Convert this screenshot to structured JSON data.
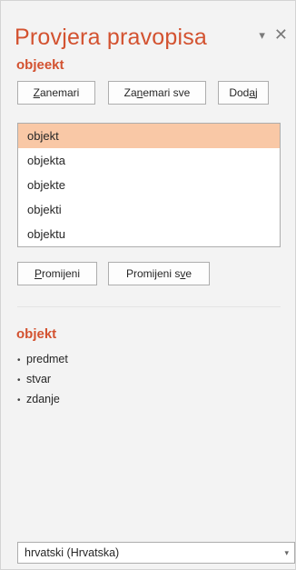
{
  "pane": {
    "title": "Provjera pravopisa",
    "misspelled_word": "objeekt",
    "dropdown_glyph": "▾",
    "close_glyph": "✕"
  },
  "buttons": {
    "ignore": {
      "pre": "",
      "ul": "Z",
      "post": "anemari"
    },
    "ignore_all": {
      "pre": "Za",
      "ul": "n",
      "post": "emari sve"
    },
    "add": {
      "pre": "Dod",
      "ul": "a",
      "post": "j"
    },
    "change": {
      "pre": "",
      "ul": "P",
      "post": "romijeni"
    },
    "change_all": {
      "pre": "Promijeni s",
      "ul": "v",
      "post": "e"
    }
  },
  "suggestions": [
    "objekt",
    "objekta",
    "objekte",
    "objekti",
    "objektu"
  ],
  "selected_suggestion_index": 0,
  "synonyms": {
    "word": "objekt",
    "bullet": "•",
    "items": [
      "predmet",
      "stvar",
      "zdanje"
    ]
  },
  "language": {
    "value": "hrvatski (Hrvatska)",
    "arrow": "▾"
  },
  "colors": {
    "accent": "#d35230",
    "selection": "#f9c8a6"
  }
}
